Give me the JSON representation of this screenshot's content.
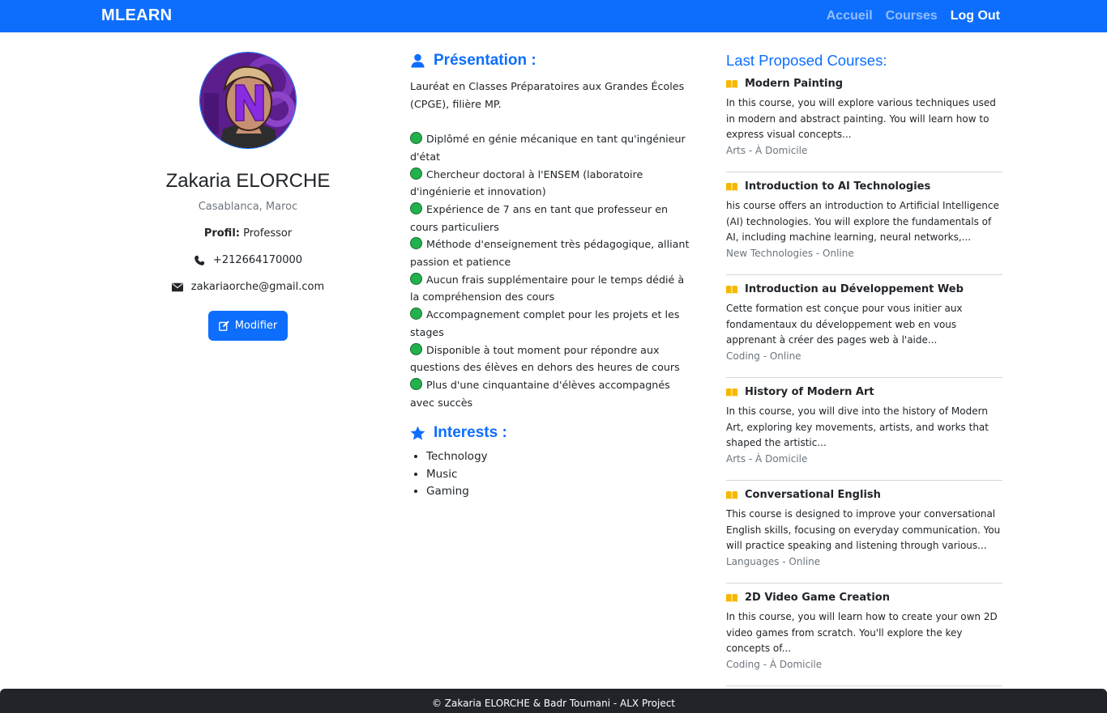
{
  "nav": {
    "brand": "MLEARN",
    "links": [
      "Accueil",
      "Courses",
      "Log Out"
    ]
  },
  "profile": {
    "name": "Zakaria ELORCHE",
    "city": "Casablanca, Maroc",
    "profil_label": "Profil:",
    "profil_value": "Professor",
    "phone": "+212664170000",
    "email": "zakariaorche@gmail.com",
    "edit_button": "Modifier"
  },
  "presentation": {
    "title": "Présentation :",
    "intro": "Lauréat en Classes Préparatoires aux Grandes Écoles (CPGE), filière MP.",
    "items": [
      "Diplômé en génie mécanique en tant qu'ingénieur d'état",
      "Chercheur doctoral à l'ENSEM (laboratoire d'ingénierie et innovation)",
      "Expérience de 7 ans en tant que professeur en cours particuliers",
      "Méthode d'enseignement très pédagogique, alliant passion et patience",
      "Aucun frais supplémentaire pour le temps dédié à la compréhension des cours",
      "Accompagnement complet pour les projets et les stages",
      "Disponible à tout moment pour répondre aux questions des élèves en dehors des heures de cours",
      "Plus d'une cinquantaine d'élèves accompagnés avec succès"
    ]
  },
  "interests": {
    "title": "Interests :",
    "items": [
      "Technology",
      "Music",
      "Gaming"
    ]
  },
  "courses": {
    "title": "Last Proposed Courses:",
    "items": [
      {
        "title": "Modern Painting",
        "desc": "In this course, you will explore various techniques used in modern and abstract painting. You will learn how to express visual concepts...",
        "meta": "Arts - À Domicile"
      },
      {
        "title": "Introduction to AI Technologies",
        "desc": "his course offers an introduction to Artificial Intelligence (AI) technologies. You will explore the fundamentals of AI, including machine learning, neural networks,...",
        "meta": "New Technologies - Online"
      },
      {
        "title": "Introduction au Développement Web",
        "desc": "Cette formation est conçue pour vous initier aux fondamentaux du développement web en vous apprenant à créer des pages web à l'aide...",
        "meta": "Coding - Online"
      },
      {
        "title": "History of Modern Art",
        "desc": "In this course, you will dive into the history of Modern Art, exploring key movements, artists, and works that shaped the artistic...",
        "meta": "Arts - À Domicile"
      },
      {
        "title": "Conversational English",
        "desc": "This course is designed to improve your conversational English skills, focusing on everyday communication. You will practice speaking and listening through various...",
        "meta": "Languages - Online"
      },
      {
        "title": "2D Video Game Creation",
        "desc": "In this course, you will learn how to create your own 2D video games from scratch. You'll explore the key concepts of...",
        "meta": "Coding - À Domicile"
      }
    ]
  },
  "footer": {
    "text": "© Zakaria ELORCHE & Badr Toumani - ALX Project"
  },
  "colors": {
    "primary": "#0d6efd",
    "footer_bg": "#212529",
    "check_green": "#22b14c",
    "book_yellow": "#f5b800"
  }
}
